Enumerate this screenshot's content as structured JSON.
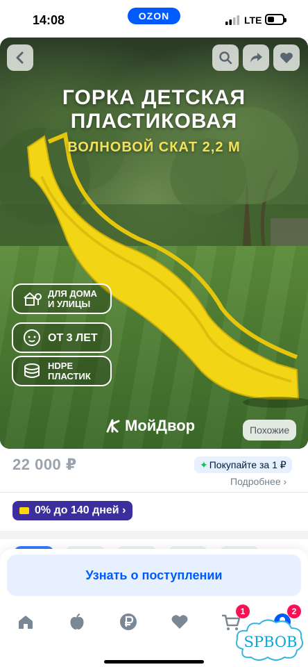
{
  "status_bar": {
    "time": "14:08",
    "app_badge": "OZON",
    "network": "LTE"
  },
  "hero": {
    "title_line1": "ГОРКА ДЕТСКАЯ",
    "title_line2": "ПЛАСТИКОВАЯ",
    "subtitle": "ВОЛНОВОЙ СКАТ 2,2 М",
    "features": [
      {
        "icon": "house-tree-icon",
        "line1": "ДЛЯ ДОМА",
        "line2": "И УЛИЦЫ"
      },
      {
        "icon": "child-face-icon",
        "line1": "ОТ 3 ЛЕТ",
        "line2": ""
      },
      {
        "icon": "layers-icon",
        "line1": "HDPE",
        "line2": "ПЛАСТИК"
      }
    ],
    "brand": "МойДвор",
    "similar_label": "Похожие"
  },
  "price": {
    "amount": "22 000 ₽",
    "promo_label": "Покупайте за 1 ₽",
    "more_label": "Подробнее ›"
  },
  "installment": {
    "label": "0% до 140 дней ›"
  },
  "notify_button": "Узнать о поступлении",
  "tabbar": {
    "cart_count": "1",
    "profile_count": "2"
  },
  "watermark": "SPBOB",
  "colors": {
    "brand_blue": "#005bff",
    "installment_purple": "#3d2e9e",
    "badge_red": "#f91155",
    "slide_yellow": "#f2d616"
  }
}
